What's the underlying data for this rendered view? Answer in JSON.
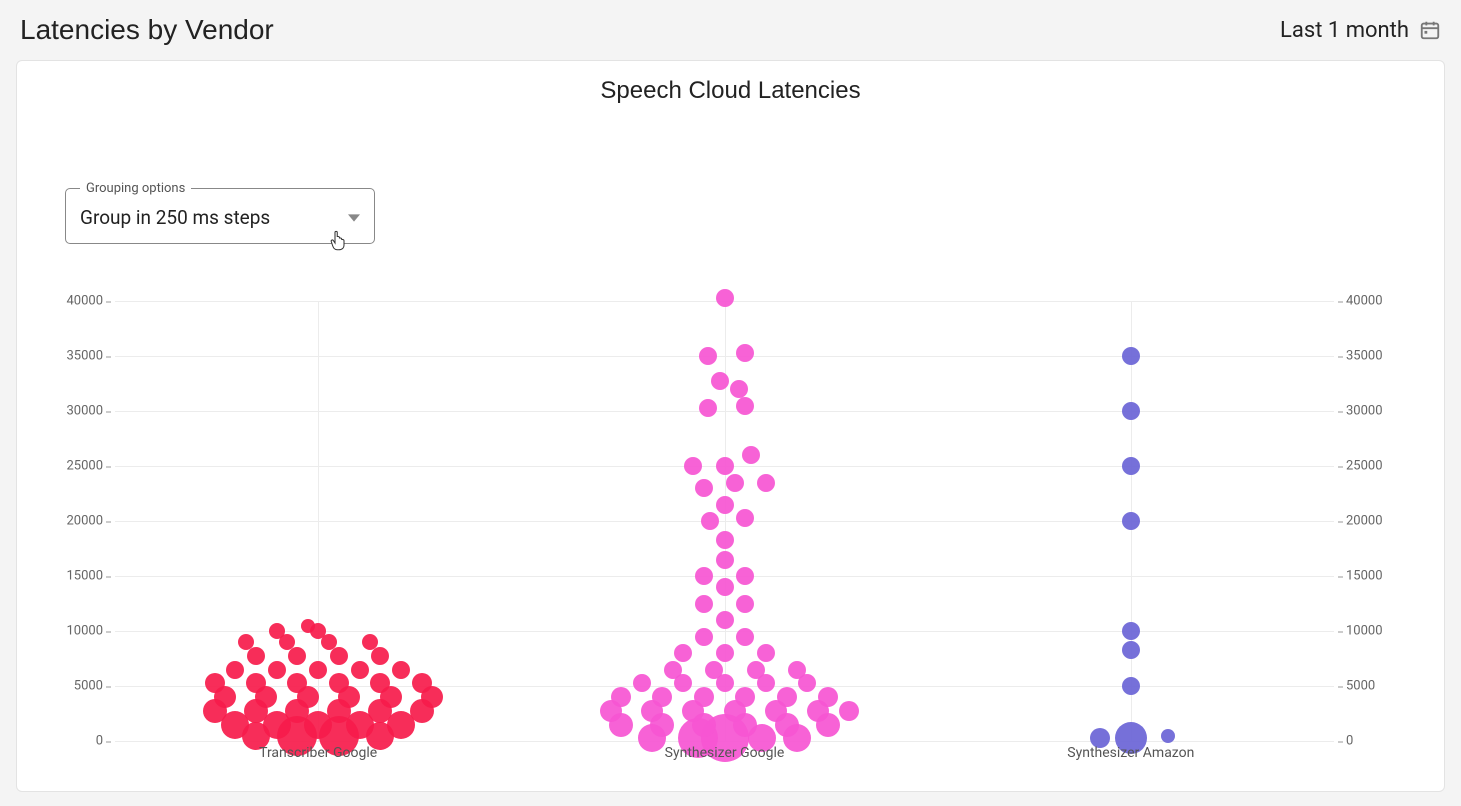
{
  "header": {
    "title": "Latencies by Vendor",
    "date_range": "Last 1 month"
  },
  "chart": {
    "title": "Speech Cloud Latencies"
  },
  "grouping": {
    "legend": "Grouping options",
    "selected": "Group in 250 ms steps"
  },
  "chart_data": {
    "type": "scatter",
    "title": "Speech Cloud Latencies",
    "xlabel": "",
    "ylabel": "",
    "ylim": [
      0,
      40000
    ],
    "y_ticks": [
      0,
      5000,
      10000,
      15000,
      20000,
      25000,
      30000,
      35000,
      40000
    ],
    "categories": [
      "Transcriber Google",
      "Synthesizer Google",
      "Synthesizer Amazon"
    ],
    "series": [
      {
        "name": "Transcriber Google",
        "color": "#f61b4b",
        "points": [
          {
            "y": 500,
            "x": -3,
            "r": 14
          },
          {
            "y": 500,
            "x": -1,
            "r": 20
          },
          {
            "y": 500,
            "x": 1,
            "r": 20
          },
          {
            "y": 500,
            "x": 3,
            "r": 14
          },
          {
            "y": 1500,
            "x": -4,
            "r": 14
          },
          {
            "y": 1500,
            "x": -2,
            "r": 14
          },
          {
            "y": 1500,
            "x": 0,
            "r": 14
          },
          {
            "y": 1500,
            "x": 2,
            "r": 14
          },
          {
            "y": 1500,
            "x": 4,
            "r": 14
          },
          {
            "y": 2750,
            "x": -5,
            "r": 12
          },
          {
            "y": 2750,
            "x": -3,
            "r": 12
          },
          {
            "y": 2750,
            "x": -1,
            "r": 12
          },
          {
            "y": 2750,
            "x": 1,
            "r": 12
          },
          {
            "y": 2750,
            "x": 3,
            "r": 12
          },
          {
            "y": 2750,
            "x": 5,
            "r": 12
          },
          {
            "y": 4000,
            "x": -4.5,
            "r": 11
          },
          {
            "y": 4000,
            "x": -2.5,
            "r": 11
          },
          {
            "y": 4000,
            "x": -0.5,
            "r": 11
          },
          {
            "y": 4000,
            "x": 1.5,
            "r": 11
          },
          {
            "y": 4000,
            "x": 3.5,
            "r": 11
          },
          {
            "y": 4000,
            "x": 5.5,
            "r": 11
          },
          {
            "y": 5250,
            "x": -5,
            "r": 10
          },
          {
            "y": 5250,
            "x": -3,
            "r": 10
          },
          {
            "y": 5250,
            "x": -1,
            "r": 10
          },
          {
            "y": 5250,
            "x": 1,
            "r": 10
          },
          {
            "y": 5250,
            "x": 3,
            "r": 10
          },
          {
            "y": 5250,
            "x": 5,
            "r": 10
          },
          {
            "y": 6500,
            "x": -4,
            "r": 9
          },
          {
            "y": 6500,
            "x": -2,
            "r": 9
          },
          {
            "y": 6500,
            "x": 0,
            "r": 9
          },
          {
            "y": 6500,
            "x": 2,
            "r": 9
          },
          {
            "y": 6500,
            "x": 4,
            "r": 9
          },
          {
            "y": 7750,
            "x": -3,
            "r": 9
          },
          {
            "y": 7750,
            "x": -1,
            "r": 9
          },
          {
            "y": 7750,
            "x": 1,
            "r": 9
          },
          {
            "y": 7750,
            "x": 3,
            "r": 9
          },
          {
            "y": 9000,
            "x": -3.5,
            "r": 8
          },
          {
            "y": 9000,
            "x": -1.5,
            "r": 8
          },
          {
            "y": 9000,
            "x": 0.5,
            "r": 8
          },
          {
            "y": 9000,
            "x": 2.5,
            "r": 8
          },
          {
            "y": 10000,
            "x": -2,
            "r": 8
          },
          {
            "y": 10000,
            "x": 0,
            "r": 8
          },
          {
            "y": 10500,
            "x": -0.5,
            "r": 7
          }
        ]
      },
      {
        "name": "Synthesizer Google",
        "color": "#f655d3",
        "points": [
          {
            "y": 250,
            "x": -3.5,
            "r": 14
          },
          {
            "y": 250,
            "x": -1.3,
            "r": 20
          },
          {
            "y": 250,
            "x": 0,
            "r": 24
          },
          {
            "y": 250,
            "x": 1.8,
            "r": 14
          },
          {
            "y": 250,
            "x": 3.5,
            "r": 14
          },
          {
            "y": 1500,
            "x": -5,
            "r": 12
          },
          {
            "y": 1500,
            "x": -3,
            "r": 12
          },
          {
            "y": 1500,
            "x": -1,
            "r": 12
          },
          {
            "y": 1500,
            "x": 1,
            "r": 12
          },
          {
            "y": 1500,
            "x": 3,
            "r": 12
          },
          {
            "y": 1500,
            "x": 5,
            "r": 12
          },
          {
            "y": 2750,
            "x": -5.5,
            "r": 11
          },
          {
            "y": 2750,
            "x": -3.5,
            "r": 11
          },
          {
            "y": 2750,
            "x": -1.5,
            "r": 11
          },
          {
            "y": 2750,
            "x": 0.5,
            "r": 11
          },
          {
            "y": 2750,
            "x": 2.5,
            "r": 11
          },
          {
            "y": 2750,
            "x": 4.5,
            "r": 11
          },
          {
            "y": 2750,
            "x": 6,
            "r": 10
          },
          {
            "y": 4000,
            "x": -5,
            "r": 10
          },
          {
            "y": 4000,
            "x": -3,
            "r": 10
          },
          {
            "y": 4000,
            "x": -1,
            "r": 10
          },
          {
            "y": 4000,
            "x": 1,
            "r": 10
          },
          {
            "y": 4000,
            "x": 3,
            "r": 10
          },
          {
            "y": 4000,
            "x": 5,
            "r": 10
          },
          {
            "y": 5250,
            "x": -4,
            "r": 9
          },
          {
            "y": 5250,
            "x": -2,
            "r": 9
          },
          {
            "y": 5250,
            "x": 0,
            "r": 9
          },
          {
            "y": 5250,
            "x": 2,
            "r": 9
          },
          {
            "y": 5250,
            "x": 4,
            "r": 9
          },
          {
            "y": 6500,
            "x": -2.5,
            "r": 9
          },
          {
            "y": 6500,
            "x": -0.5,
            "r": 9
          },
          {
            "y": 6500,
            "x": 1.5,
            "r": 9
          },
          {
            "y": 6500,
            "x": 3.5,
            "r": 9
          },
          {
            "y": 8000,
            "x": -2,
            "r": 9
          },
          {
            "y": 8000,
            "x": 0,
            "r": 9
          },
          {
            "y": 8000,
            "x": 2,
            "r": 9
          },
          {
            "y": 9500,
            "x": -1,
            "r": 9
          },
          {
            "y": 9500,
            "x": 1,
            "r": 9
          },
          {
            "y": 11000,
            "x": 0,
            "r": 9
          },
          {
            "y": 12500,
            "x": -1,
            "r": 9
          },
          {
            "y": 12500,
            "x": 1,
            "r": 9
          },
          {
            "y": 14000,
            "x": 0,
            "r": 9
          },
          {
            "y": 15000,
            "x": -1,
            "r": 9
          },
          {
            "y": 15000,
            "x": 1,
            "r": 9
          },
          {
            "y": 16500,
            "x": 0,
            "r": 9
          },
          {
            "y": 18250,
            "x": 0,
            "r": 9
          },
          {
            "y": 20000,
            "x": -0.7,
            "r": 9
          },
          {
            "y": 20250,
            "x": 1,
            "r": 9
          },
          {
            "y": 21500,
            "x": 0,
            "r": 9
          },
          {
            "y": 23000,
            "x": -1,
            "r": 9
          },
          {
            "y": 23500,
            "x": 0.5,
            "r": 9
          },
          {
            "y": 23500,
            "x": 2,
            "r": 9
          },
          {
            "y": 25000,
            "x": -1.5,
            "r": 9
          },
          {
            "y": 25000,
            "x": 0,
            "r": 9
          },
          {
            "y": 26000,
            "x": 1.3,
            "r": 9
          },
          {
            "y": 30250,
            "x": -0.8,
            "r": 9
          },
          {
            "y": 30500,
            "x": 1,
            "r": 9
          },
          {
            "y": 32000,
            "x": 0.7,
            "r": 9
          },
          {
            "y": 32750,
            "x": -0.2,
            "r": 9
          },
          {
            "y": 35000,
            "x": -0.8,
            "r": 9
          },
          {
            "y": 35250,
            "x": 1,
            "r": 9
          },
          {
            "y": 40250,
            "x": 0,
            "r": 9
          }
        ]
      },
      {
        "name": "Synthesizer Amazon",
        "color": "#6a64d6",
        "points": [
          {
            "y": 250,
            "x": -1.5,
            "r": 10
          },
          {
            "y": 250,
            "x": 0,
            "r": 16
          },
          {
            "y": 500,
            "x": 1.8,
            "r": 7
          },
          {
            "y": 5000,
            "x": 0,
            "r": 9
          },
          {
            "y": 8250,
            "x": 0,
            "r": 9
          },
          {
            "y": 10000,
            "x": 0,
            "r": 9
          },
          {
            "y": 20000,
            "x": 0,
            "r": 9
          },
          {
            "y": 25000,
            "x": 0,
            "r": 9
          },
          {
            "y": 30000,
            "x": 0,
            "r": 9
          },
          {
            "y": 35000,
            "x": 0,
            "r": 9
          }
        ]
      }
    ]
  }
}
